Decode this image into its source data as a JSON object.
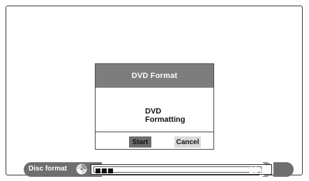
{
  "dialog": {
    "title": "DVD Format",
    "message_line1": "DVD",
    "message_line2": "Formatting",
    "buttons": {
      "start_label": "Start",
      "cancel_label": "Cancel"
    }
  },
  "status_bar": {
    "label": "Disc format",
    "icon": "disc-icon",
    "progress_percent": 18,
    "progress_value": "18",
    "progress_unit": "%",
    "filled_segments": 3
  },
  "colors": {
    "title_bar": "#7d7d7d",
    "selected_button": "#6e6e6e",
    "unselected_button": "#d9d9d9",
    "status_pill": "#6f6f6f"
  }
}
